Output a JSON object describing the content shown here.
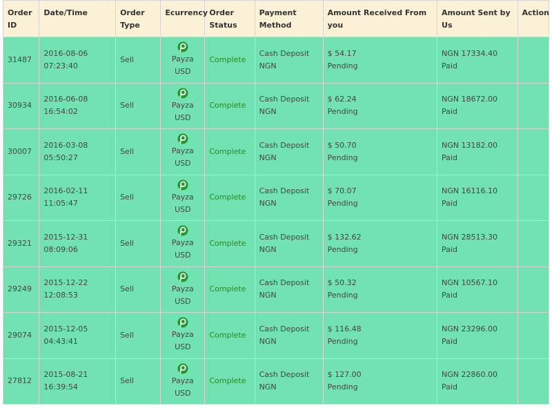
{
  "table": {
    "headers": {
      "order_id": "Order ID",
      "date_time": "Date/Time",
      "order_type": "Order Type",
      "ecurrency": "Ecurrency",
      "order_status": "Order Status",
      "payment_method": "Payment Method",
      "amount_received": "Amount Received From you",
      "amount_sent": "Amount Sent by Us",
      "action": "Action"
    },
    "rows": [
      {
        "id": "31487",
        "date": "2016-08-06",
        "time": "07:23:40",
        "type": "Sell",
        "ecurrency_name": "Payza",
        "ecurrency_code": "USD",
        "status": "Complete",
        "payment_line1": "Cash Deposit",
        "payment_line2": "NGN",
        "received_amount": "$ 54.17",
        "received_status": "Pending",
        "sent_amount": "NGN 17334.40",
        "sent_status": "Paid"
      },
      {
        "id": "30934",
        "date": "2016-06-08",
        "time": "16:54:02",
        "type": "Sell",
        "ecurrency_name": "Payza",
        "ecurrency_code": "USD",
        "status": "Complete",
        "payment_line1": "Cash Deposit",
        "payment_line2": "NGN",
        "received_amount": "$ 62.24",
        "received_status": "Pending",
        "sent_amount": "NGN 18672.00",
        "sent_status": "Paid"
      },
      {
        "id": "30007",
        "date": "2016-03-08",
        "time": "05:50:27",
        "type": "Sell",
        "ecurrency_name": "Payza",
        "ecurrency_code": "USD",
        "status": "Complete",
        "payment_line1": "Cash Deposit",
        "payment_line2": "NGN",
        "received_amount": "$ 50.70",
        "received_status": "Pending",
        "sent_amount": "NGN 13182.00",
        "sent_status": "Paid"
      },
      {
        "id": "29726",
        "date": "2016-02-11",
        "time": "11:05:47",
        "type": "Sell",
        "ecurrency_name": "Payza",
        "ecurrency_code": "USD",
        "status": "Complete",
        "payment_line1": "Cash Deposit",
        "payment_line2": "NGN",
        "received_amount": "$ 70.07",
        "received_status": "Pending",
        "sent_amount": "NGN 16116.10",
        "sent_status": "Paid"
      },
      {
        "id": "29321",
        "date": "2015-12-31",
        "time": "08:09:06",
        "type": "Sell",
        "ecurrency_name": "Payza",
        "ecurrency_code": "USD",
        "status": "Complete",
        "payment_line1": "Cash Deposit",
        "payment_line2": "NGN",
        "received_amount": "$ 132.62",
        "received_status": "Pending",
        "sent_amount": "NGN 28513.30",
        "sent_status": "Paid"
      },
      {
        "id": "29249",
        "date": "2015-12-22",
        "time": "12:08:53",
        "type": "Sell",
        "ecurrency_name": "Payza",
        "ecurrency_code": "USD",
        "status": "Complete",
        "payment_line1": "Cash Deposit",
        "payment_line2": "NGN",
        "received_amount": "$ 50.32",
        "received_status": "Pending",
        "sent_amount": "NGN 10567.10",
        "sent_status": "Paid"
      },
      {
        "id": "29074",
        "date": "2015-12-05",
        "time": "04:43:41",
        "type": "Sell",
        "ecurrency_name": "Payza",
        "ecurrency_code": "USD",
        "status": "Complete",
        "payment_line1": "Cash Deposit",
        "payment_line2": "NGN",
        "received_amount": "$ 116.48",
        "received_status": "Pending",
        "sent_amount": "NGN 23296.00",
        "sent_status": "Paid"
      },
      {
        "id": "27812",
        "date": "2015-08-21",
        "time": "16:39:54",
        "type": "Sell",
        "ecurrency_name": "Payza",
        "ecurrency_code": "USD",
        "status": "Complete",
        "payment_line1": "Cash Deposit",
        "payment_line2": "NGN",
        "received_amount": "$ 127.00",
        "received_status": "Pending",
        "sent_amount": "NGN 22860.00",
        "sent_status": "Paid"
      }
    ]
  },
  "icons": {
    "ecurrency_icon": "payza-icon"
  },
  "colors": {
    "header_bg": "#fbf1d6",
    "row_bg": "#72e2b2",
    "status_text": "#2a8a1e",
    "payza_green": "#1e9a2a"
  }
}
